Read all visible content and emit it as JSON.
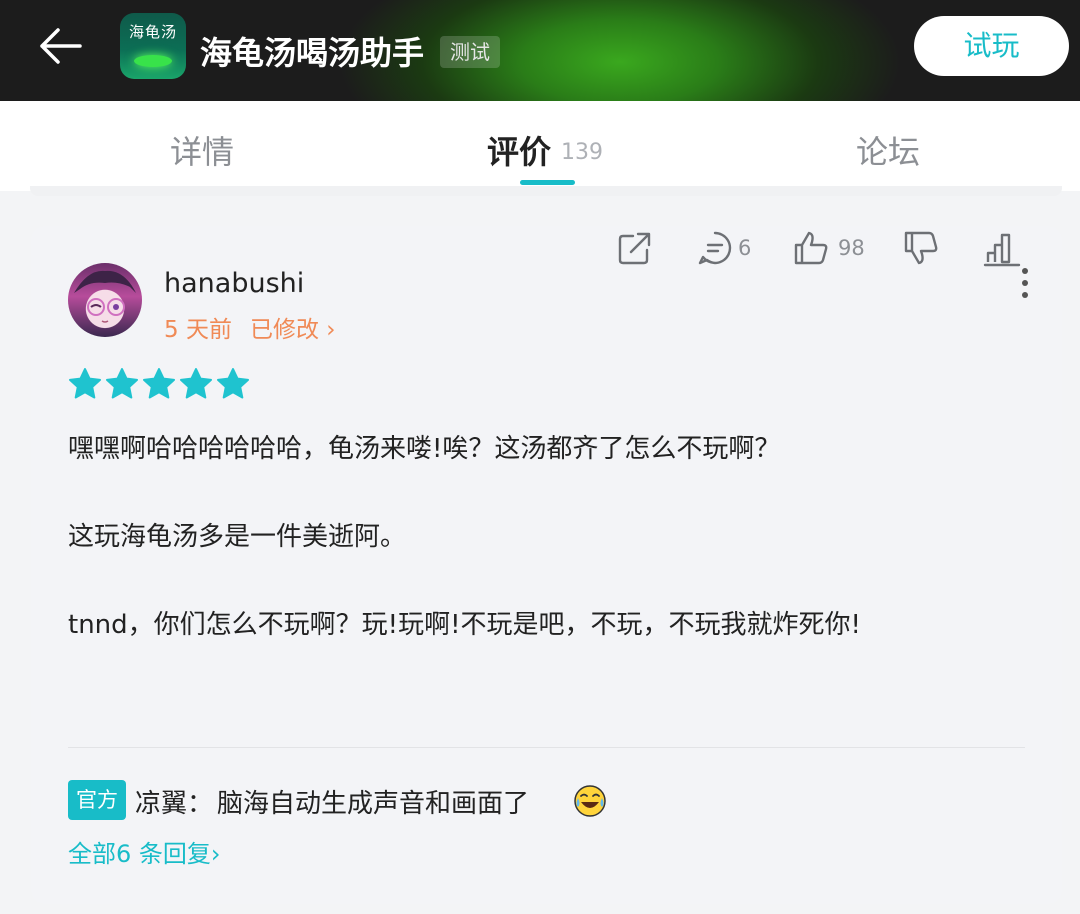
{
  "header": {
    "app_icon_text": "海龟汤",
    "app_title": "海龟汤喝汤助手",
    "badge": "测试",
    "try_button": "试玩"
  },
  "tabs": {
    "details": "详情",
    "reviews": "评价",
    "reviews_count": "139",
    "forum": "论坛",
    "active": "reviews"
  },
  "review": {
    "username": "hanabushi",
    "time": "5 天前",
    "edited": "已修改 ›",
    "rating": 5,
    "paragraphs": [
      "嘿嘿啊哈哈哈哈哈哈，龟汤来喽!唉？这汤都齐了怎么不玩啊？",
      "这玩海龟汤多是一件美逝阿。",
      "tnnd，你们怎么不玩啊？玩!玩啊!不玩是吧，不玩，不玩我就炸死你!"
    ],
    "actions": {
      "comment_count": "6",
      "like_count": "98"
    },
    "reply": {
      "badge": "官方",
      "author": "凉翼：",
      "text": "脑海自动生成声音和画面了",
      "all_replies": "全部6 条回复›"
    }
  },
  "colors": {
    "accent": "#18bcc8",
    "meta_orange": "#f08a56",
    "star": "#1fc3cf"
  }
}
